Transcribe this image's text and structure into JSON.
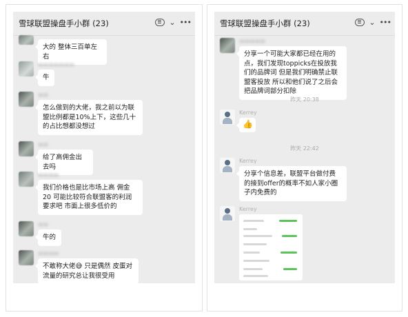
{
  "left_window": {
    "title": "雪球联盟操盘手小群 (23)",
    "messages": [
      {
        "text": "大的 整体三百单左右"
      },
      {
        "text": "牛"
      },
      {
        "text": "怎么做到的大佬，我之前以为联盟比例都是10%上下，这些几十的占比想都没想过"
      },
      {
        "text": "给了高佣金出去吗"
      },
      {
        "text": "我们价格也是比市场上高 佣金20 可能比较符合联盟客的利润要求吧 市面上很多低价的"
      },
      {
        "text": "牛的"
      },
      {
        "text": "不敢称大佬😅 只是偶然 皮蛋对流量的研究总让我很受用"
      }
    ]
  },
  "right_window": {
    "title": "雪球联盟操盘手小群 (23)",
    "messages": [
      {
        "text": "分享一个可能大家都已经在用的点，我们发现toppicks在投放我们的品牌词 但是我们明确禁止联盟客投放 所以和他们说了之后会把品牌词部分扣除"
      },
      {
        "time": "昨天 20:38"
      },
      {
        "sender": "Kerrey",
        "text": "👍"
      },
      {
        "time": "昨天 22:42"
      },
      {
        "sender": "Kerrey",
        "text": "分享个信息差，联盟平台做付费的接到offer的概率不如人家小圈子内免费的"
      },
      {
        "sender": "Kerrey",
        "image": "screenshot-image"
      }
    ]
  },
  "icons": {
    "chat": "chat-bubble-icon",
    "dropdown": "chevron-down-icon",
    "more": "more-dots-icon"
  },
  "colors": {
    "chat_bg": "#ececec",
    "bubble_bg": "#ffffff",
    "green": "#5ac35a"
  }
}
